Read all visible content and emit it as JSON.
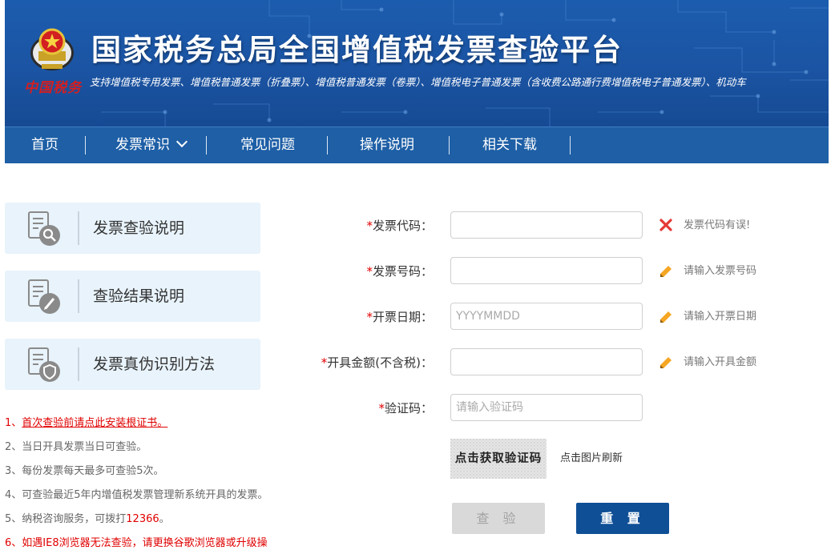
{
  "header": {
    "brand_seal": "中国税务",
    "title": "国家税务总局全国增值税发票查验平台",
    "subtitle": "支持增值税专用发票、增值税普通发票（折叠票）、增值税普通发票（卷票）、增值税电子普通发票（含收费公路通行费增值税电子普通发票）、机动车"
  },
  "nav": {
    "items": [
      {
        "label": "首页"
      },
      {
        "label": "发票常识",
        "icon": "chevron-down-icon"
      },
      {
        "label": "常见问题"
      },
      {
        "label": "操作说明"
      },
      {
        "label": "相关下载"
      }
    ]
  },
  "sidebar": {
    "cards": [
      {
        "label": "发票查验说明",
        "icon": "document-search-icon"
      },
      {
        "label": "查验结果说明",
        "icon": "document-edit-icon"
      },
      {
        "label": "发票真伪识别方法",
        "icon": "document-shield-icon"
      }
    ],
    "notices": [
      {
        "text": "1、",
        "link": "首次查验前请点此安装根证书。"
      },
      {
        "text": "2、当日开具发票当日可查验。"
      },
      {
        "text": "3、每份发票每天最多可查验5次。"
      },
      {
        "text": "4、可查验最近5年内增值税发票管理新系统开具的发票。"
      },
      {
        "text": "5、纳税咨询服务，可拨打",
        "number": "12366",
        "suffix": "。"
      },
      {
        "text": "6、如遇IE8浏览器无法查验，请更换谷歌浏览器或升级操"
      }
    ]
  },
  "form": {
    "required_mark": "*",
    "fields": [
      {
        "label": "发票代码：",
        "value": "",
        "placeholder": "",
        "hint": "发票代码有误!",
        "hint_icon": "close-icon",
        "status": "error"
      },
      {
        "label": "发票号码：",
        "value": "",
        "placeholder": "",
        "hint": "请输入发票号码",
        "hint_icon": "pencil-icon"
      },
      {
        "label": "开票日期：",
        "value": "",
        "placeholder": "YYYYMMDD",
        "hint": "请输入开票日期",
        "hint_icon": "pencil-icon"
      },
      {
        "label": "开具金额(不含税)：",
        "value": "",
        "placeholder": "",
        "hint": "请输入开具金额",
        "hint_icon": "pencil-icon"
      },
      {
        "label": "验证码：",
        "value": "",
        "placeholder": "请输入验证码"
      }
    ],
    "captcha_text": "点击获取验证码",
    "captcha_refresh": "点击图片刷新",
    "buttons": {
      "query": "查 验",
      "reset": "重 置"
    }
  },
  "colors": {
    "banner": "#1b54a3",
    "nav": "#1e5fa6",
    "card": "#e8f3fb",
    "error": "#e53935",
    "pencil": "#f5a623",
    "primary_button": "#0f4f96",
    "disabled_button": "#d9d9d9",
    "notice_red": "#e00000"
  }
}
